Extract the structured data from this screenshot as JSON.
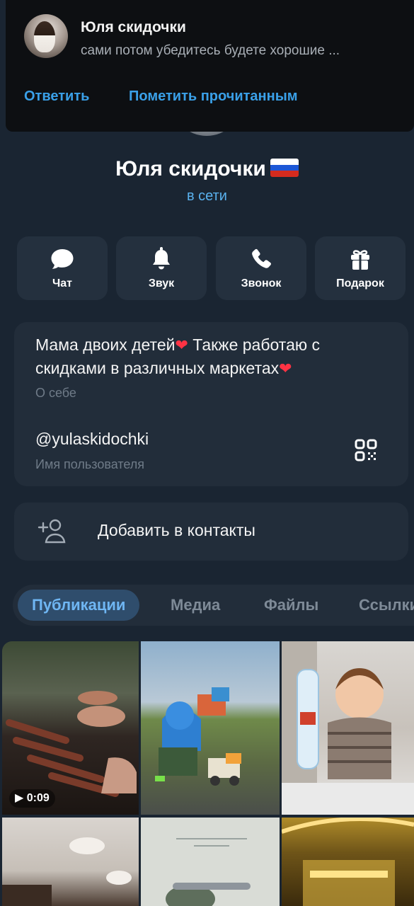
{
  "notification": {
    "title": "Юля скидочки",
    "text": "сами потом убедитесь будете хорошие ...",
    "reply_label": "Ответить",
    "mark_read_label": "Пометить прочитанным"
  },
  "profile": {
    "name": "Юля скидочки",
    "status": "в сети",
    "flag_colors": [
      "#ffffff",
      "#1c57d6",
      "#d52b1e"
    ]
  },
  "actions": [
    {
      "label": "Чат",
      "icon": "chat-bubble-icon"
    },
    {
      "label": "Звук",
      "icon": "bell-icon"
    },
    {
      "label": "Звонок",
      "icon": "phone-icon"
    },
    {
      "label": "Подарок",
      "icon": "gift-icon"
    }
  ],
  "info": {
    "bio_line1": "Мама двоих детей",
    "bio_line1_rest": " Также работаю с",
    "bio_line2": "скидками в различных маркетах",
    "bio_caption": "О себе",
    "username": "@yulaskidochki",
    "username_caption": "Имя пользователя"
  },
  "contact": {
    "label": "Добавить в контакты"
  },
  "tabs": [
    {
      "label": "Публикации",
      "active": true
    },
    {
      "label": "Медиа",
      "active": false
    },
    {
      "label": "Файлы",
      "active": false
    },
    {
      "label": "Ссылки",
      "active": false
    }
  ],
  "media": [
    {
      "type": "video",
      "duration": "0:09",
      "subject": "grill skewers"
    },
    {
      "type": "photo",
      "subject": "child with toy truck in park"
    },
    {
      "type": "photo",
      "subject": "child with water bottle"
    },
    {
      "type": "photo",
      "subject": "baby feet"
    },
    {
      "type": "photo",
      "subject": "text note"
    },
    {
      "type": "photo",
      "subject": "lit interior"
    }
  ],
  "colors": {
    "accent": "#5ab2ef",
    "background": "#1a2532",
    "card": "#222d3a"
  }
}
